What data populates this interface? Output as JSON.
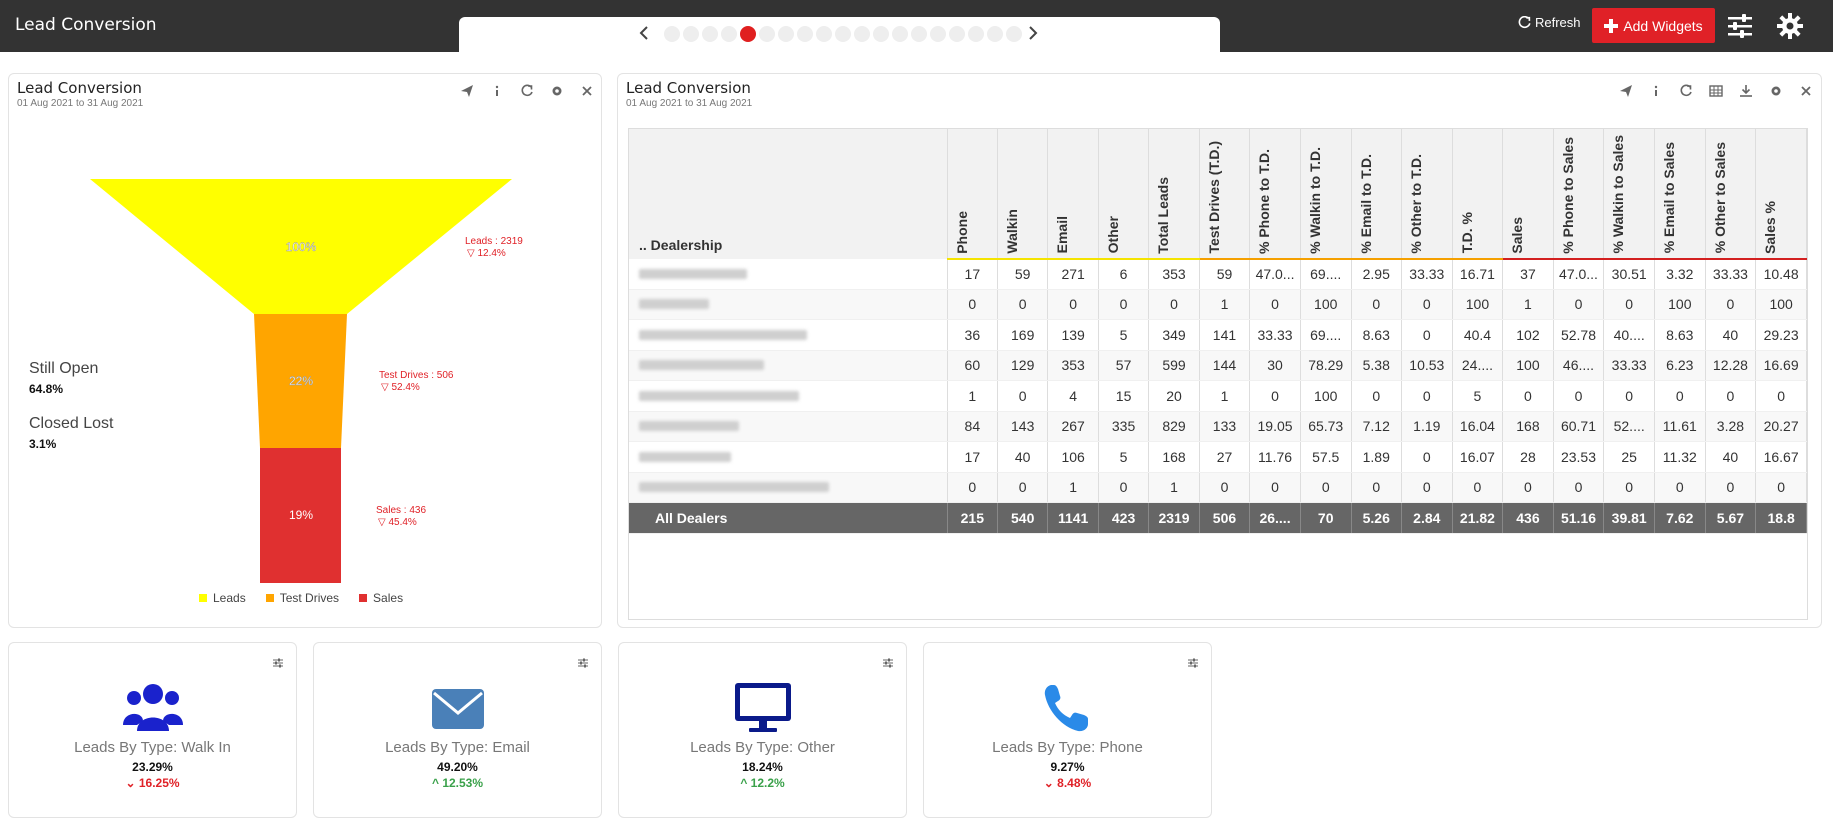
{
  "header": {
    "title": "Lead Conversion",
    "refresh_label": "Refresh",
    "add_widgets_label": "Add Widgets",
    "page_count": 19,
    "active_page": 5
  },
  "funnel_panel": {
    "title": "Lead Conversion",
    "date_range": "01 Aug 2021 to 31 Aug 2021",
    "stages": [
      {
        "name": "Leads",
        "pct_label": "100%",
        "label": "Leads : 2319",
        "change": "▽ 12.4%",
        "color": "#ffff00"
      },
      {
        "name": "Test Drives",
        "pct_label": "22%",
        "label": "Test Drives : 506",
        "change": "▽ 52.4%",
        "color": "#ffa500"
      },
      {
        "name": "Sales",
        "pct_label": "19%",
        "label": "Sales : 436",
        "change": "▽ 45.4%",
        "color": "#e03030"
      }
    ],
    "still_open_label": "Still Open",
    "still_open_value": "64.8%",
    "closed_lost_label": "Closed Lost",
    "closed_lost_value": "3.1%",
    "legend": [
      "Leads",
      "Test Drives",
      "Sales"
    ]
  },
  "table_panel": {
    "title": "Lead Conversion",
    "date_range": "01 Aug 2021 to 31 Aug 2021",
    "dealer_header": "Dealership",
    "sort_glyph": "..",
    "columns": [
      "Phone",
      "Walkin",
      "Email",
      "Other",
      "Total Leads",
      "Test Drives (T.D.)",
      "% Phone to T.D.",
      "% Walkin to T.D.",
      "% Email to T.D.",
      "% Other to T.D.",
      "T.D. %",
      "Sales",
      "% Phone to Sales",
      "% Walkin to Sales",
      "% Email to Sales",
      "% Other to Sales",
      "Sales %"
    ],
    "rows": [
      [
        "17",
        "59",
        "271",
        "6",
        "353",
        "59",
        "47.0...",
        "69....",
        "2.95",
        "33.33",
        "16.71",
        "37",
        "47.0...",
        "30.51",
        "3.32",
        "33.33",
        "10.48"
      ],
      [
        "0",
        "0",
        "0",
        "0",
        "0",
        "1",
        "0",
        "100",
        "0",
        "0",
        "100",
        "1",
        "0",
        "0",
        "100",
        "0",
        "100"
      ],
      [
        "36",
        "169",
        "139",
        "5",
        "349",
        "141",
        "33.33",
        "69....",
        "8.63",
        "0",
        "40.4",
        "102",
        "52.78",
        "40....",
        "8.63",
        "40",
        "29.23"
      ],
      [
        "60",
        "129",
        "353",
        "57",
        "599",
        "144",
        "30",
        "78.29",
        "5.38",
        "10.53",
        "24....",
        "100",
        "46....",
        "33.33",
        "6.23",
        "12.28",
        "16.69"
      ],
      [
        "1",
        "0",
        "4",
        "15",
        "20",
        "1",
        "0",
        "100",
        "0",
        "0",
        "5",
        "0",
        "0",
        "0",
        "0",
        "0",
        "0"
      ],
      [
        "84",
        "143",
        "267",
        "335",
        "829",
        "133",
        "19.05",
        "65.73",
        "7.12",
        "1.19",
        "16.04",
        "168",
        "60.71",
        "52....",
        "11.61",
        "3.28",
        "20.27"
      ],
      [
        "17",
        "40",
        "106",
        "5",
        "168",
        "27",
        "11.76",
        "57.5",
        "1.89",
        "0",
        "16.07",
        "28",
        "23.53",
        "25",
        "11.32",
        "40",
        "16.67"
      ],
      [
        "0",
        "0",
        "1",
        "0",
        "1",
        "0",
        "0",
        "0",
        "0",
        "0",
        "0",
        "0",
        "0",
        "0",
        "0",
        "0",
        "0"
      ]
    ],
    "total_label": "All Dealers",
    "totals": [
      "215",
      "540",
      "1141",
      "423",
      "2319",
      "506",
      "26....",
      "70",
      "5.26",
      "2.84",
      "21.82",
      "436",
      "51.16",
      "39.81",
      "7.62",
      "5.67",
      "18.8"
    ]
  },
  "kpis": [
    {
      "label": "Leads By Type: Walk In",
      "value": "23.29%",
      "change": "16.25%",
      "direction": "down",
      "icon": "users-icon",
      "color": "#1a22cc"
    },
    {
      "label": "Leads By Type: Email",
      "value": "49.20%",
      "change": "12.53%",
      "direction": "up",
      "icon": "envelope-icon",
      "color": "#4a80b8"
    },
    {
      "label": "Leads By Type: Other",
      "value": "18.24%",
      "change": "12.2%",
      "direction": "up",
      "icon": "monitor-icon",
      "color": "#0a1a8a"
    },
    {
      "label": "Leads By Type: Phone",
      "value": "9.27%",
      "change": "8.48%",
      "direction": "down",
      "icon": "phone-icon",
      "color": "#2a8ae8"
    }
  ]
}
